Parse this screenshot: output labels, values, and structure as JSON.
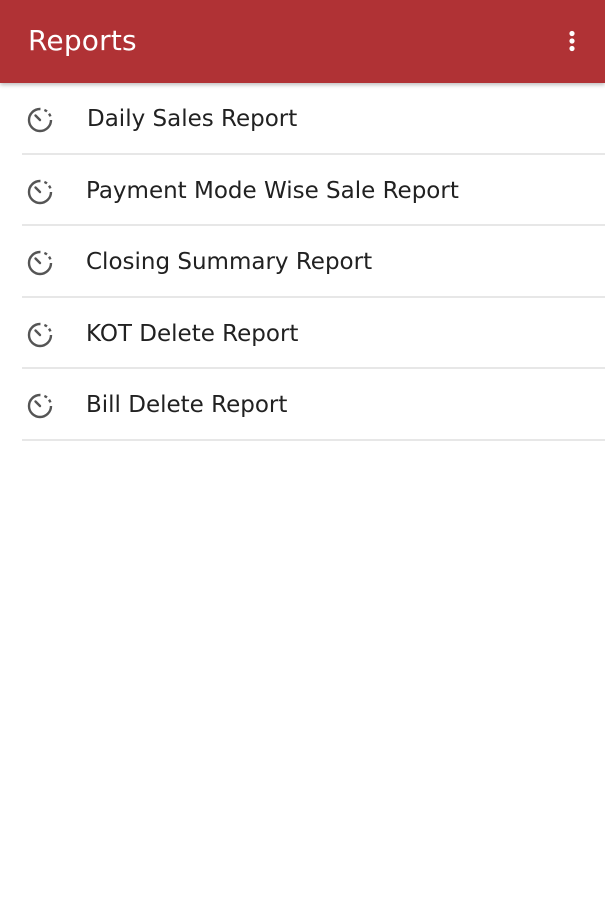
{
  "appbar": {
    "title": "Reports",
    "background": "#b03235",
    "menu_icon": "more-vert-icon"
  },
  "reports": [
    {
      "label": "Daily Sales Report",
      "icon": "timer-icon"
    },
    {
      "label": "Payment Mode Wise Sale Report",
      "icon": "timer-icon"
    },
    {
      "label": "Closing Summary Report",
      "icon": "timer-icon"
    },
    {
      "label": "KOT Delete Report",
      "icon": "timer-icon"
    },
    {
      "label": "Bill Delete Report",
      "icon": "timer-icon"
    }
  ]
}
